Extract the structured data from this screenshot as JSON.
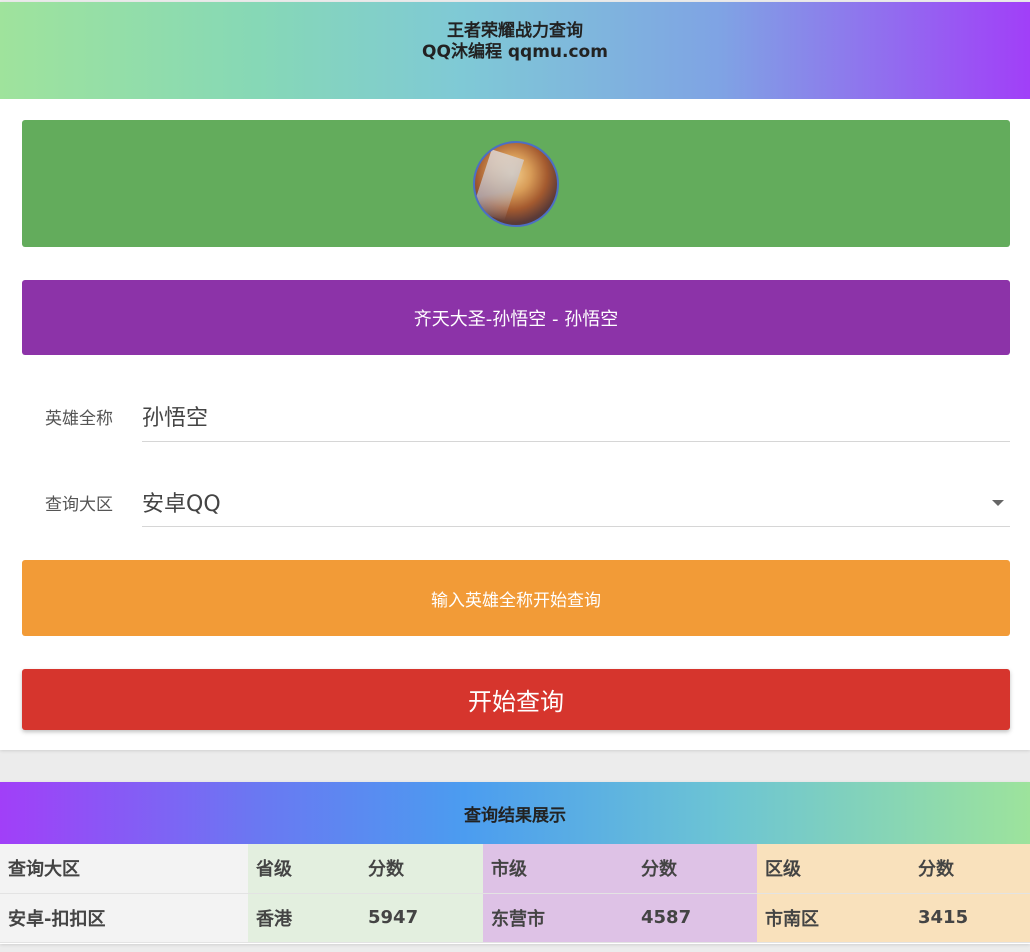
{
  "header": {
    "title": "王者荣耀战力查询",
    "subtitle": "QQ沐编程 qqmu.com"
  },
  "hero": {
    "avatar_icon": "hero-avatar-icon",
    "banner": "齐天大圣-孙悟空 - 孙悟空"
  },
  "form": {
    "hero_name_label": "英雄全称",
    "hero_name_value": "孙悟空",
    "server_label": "查询大区",
    "server_value": "安卓QQ"
  },
  "hint": "输入英雄全称开始查询",
  "query_button": "开始查询",
  "results": {
    "title": "查询结果展示",
    "headers": [
      "查询大区",
      "省级",
      "分数",
      "市级",
      "分数",
      "区级",
      "分数"
    ],
    "row": [
      "安卓-扣扣区",
      "香港",
      "5947",
      "东营市",
      "4587",
      "市南区",
      "3415"
    ]
  },
  "colors": {
    "avatar_box": "#63ac5c",
    "hero_banner": "#8c33a8",
    "hint_bar": "#f29b37",
    "query_button": "#d6352d",
    "province_col": "#e3efdf",
    "city_col": "#dec2e6",
    "district_col": "#f9e1bc"
  }
}
